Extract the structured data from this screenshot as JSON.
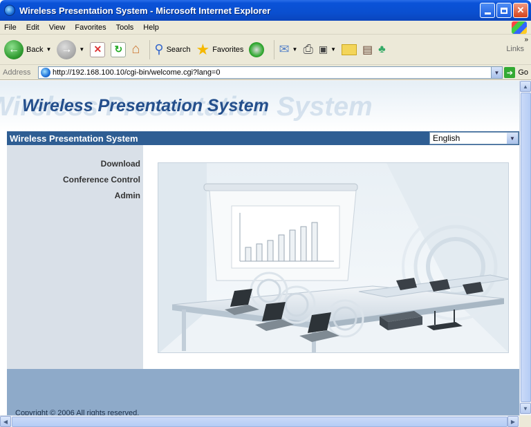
{
  "window": {
    "title": "Wireless Presentation System - Microsoft Internet Explorer"
  },
  "menu": [
    "File",
    "Edit",
    "View",
    "Favorites",
    "Tools",
    "Help"
  ],
  "toolbar": {
    "back_label": "Back",
    "search_label": "Search",
    "favorites_label": "Favorites",
    "links_label": "Links"
  },
  "address": {
    "label": "Address",
    "url": "http://192.168.100.10/cgi-bin/welcome.cgi?lang=0",
    "go_label": "Go"
  },
  "page": {
    "logo_text": "Wireless Presentation System",
    "ghost_text": "Wireless Presentation System",
    "nav_title": "Wireless Presentation System",
    "language": {
      "selected": "English"
    },
    "nav_links": [
      "Download",
      "Conference Control",
      "Admin"
    ],
    "copyright": "Copyright © 2006 All rights reserved."
  },
  "icons": {
    "back": "back-arrow-icon",
    "forward": "forward-arrow-icon",
    "stop": "stop-icon",
    "refresh": "refresh-icon",
    "home": "home-icon",
    "search": "search-icon",
    "favorites": "favorites-star-icon",
    "media": "media-icon",
    "mail": "mail-icon",
    "print": "print-icon",
    "edit": "edit-icon",
    "folder": "folder-icon",
    "research": "research-icon",
    "messenger": "messenger-icon"
  },
  "colors": {
    "title_bar": "#0a52d8",
    "nav_bar": "#2f5e93",
    "left_nav": "#d9e0e8",
    "footer": "#8eaac9",
    "logo_text": "#244f8c"
  }
}
